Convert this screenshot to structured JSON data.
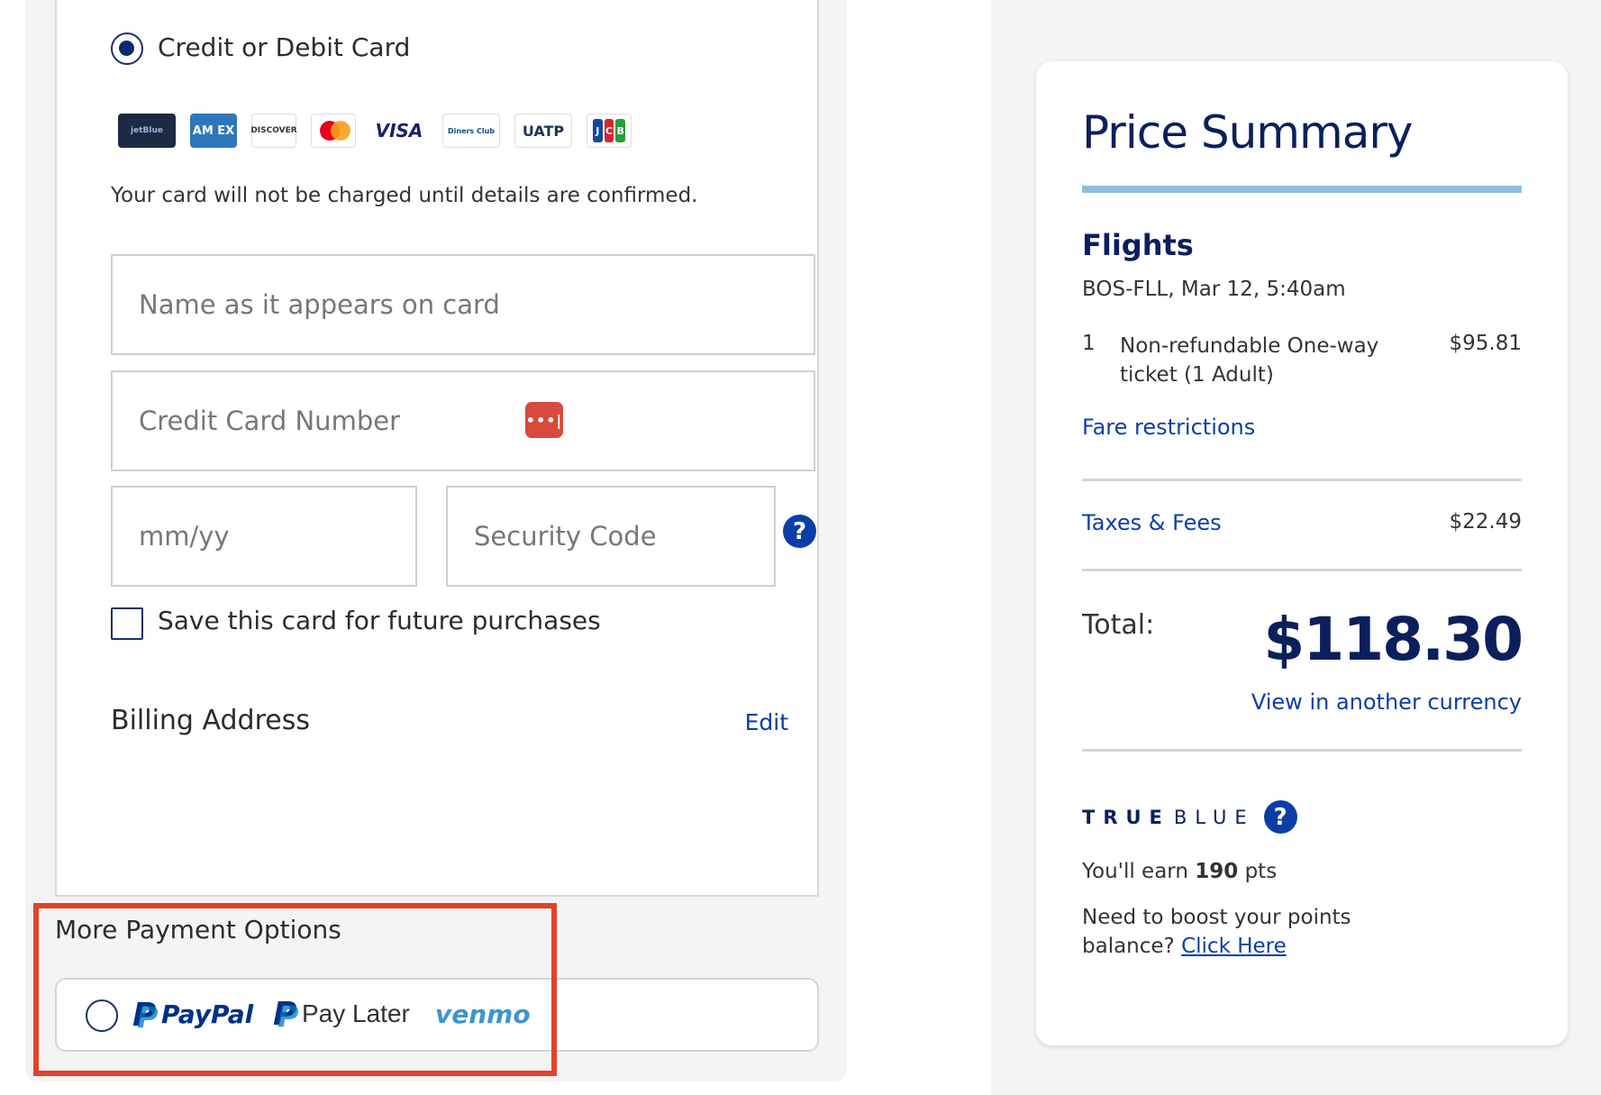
{
  "payment": {
    "card_option_label": "Credit or Debit Card",
    "card_logos": [
      "jetBlue",
      "AMEX",
      "DISCOVER",
      "Mastercard",
      "VISA",
      "Diners Club",
      "UATP",
      "JCB"
    ],
    "notice": "Your card will not be charged until details are confirmed.",
    "name_placeholder": "Name as it appears on card",
    "number_placeholder": "Credit Card Number",
    "expiry_placeholder": "mm/yy",
    "security_placeholder": "Security Code",
    "save_card_label": "Save this card for future purchases",
    "billing_title": "Billing Address",
    "billing_edit": "Edit",
    "more_options_title": "More Payment Options",
    "paypal_label": "PayPal",
    "paylater_label": "Pay Later",
    "venmo_label": "venmo"
  },
  "summary": {
    "title": "Price Summary",
    "flights_title": "Flights",
    "route": "BOS-FLL, Mar 12, 5:40am",
    "ticket_qty": "1",
    "ticket_desc_1": "Non-refundable One-way",
    "ticket_desc_2": "ticket (1 Adult)",
    "ticket_price": "$95.81",
    "fare_restrictions": "Fare restrictions",
    "taxes_label": "Taxes & Fees",
    "taxes_value": "$22.49",
    "total_label": "Total:",
    "total_value": "$118.30",
    "currency_link": "View in another currency",
    "trueblue_bold": "TRUE",
    "trueblue_light": "BLUE",
    "earn_prefix": "You'll earn ",
    "earn_points": "190",
    "earn_suffix": " pts",
    "boost_line1": "Need to boost your points",
    "boost_line2": "balance? ",
    "boost_link": "Click Here"
  },
  "colors": {
    "brand_navy": "#0b1f5c",
    "link_blue": "#0b3ea8",
    "highlight_red": "#e2412a",
    "accent_bar": "#8fbde0"
  }
}
